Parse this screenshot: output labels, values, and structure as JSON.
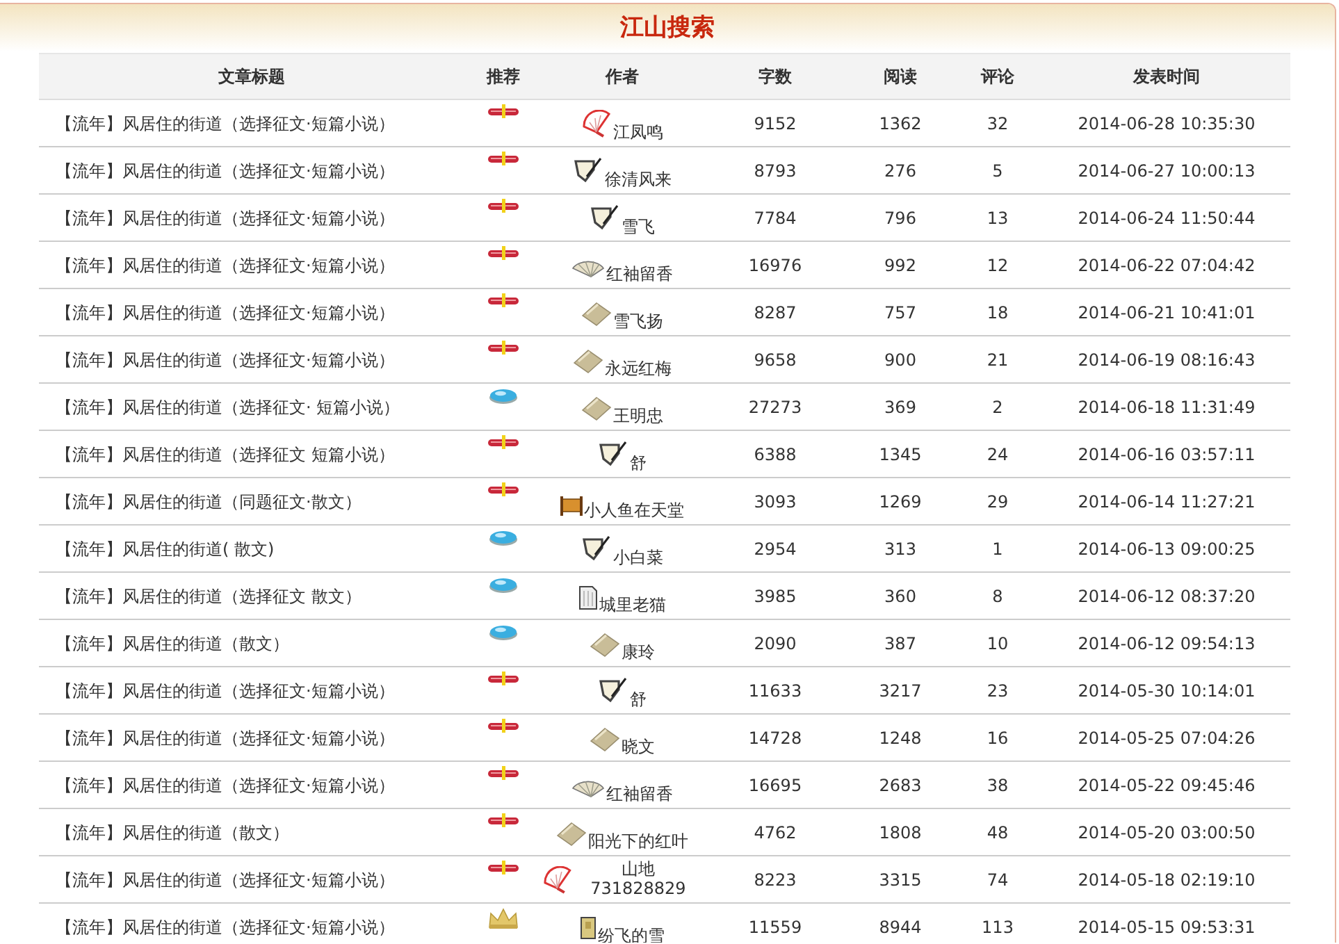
{
  "title": "江山搜索",
  "table": {
    "columns": [
      "文章标题",
      "推荐",
      "作者",
      "字数",
      "阅读",
      "评论",
      "发表时间"
    ],
    "rows": [
      {
        "title": "【流年】风居住的街道（选择征文·短篇小说）",
        "recommend": {
          "kind": "ribbon"
        },
        "author": {
          "kind": "fan-red",
          "name": "江凤鸣"
        },
        "words": "9152",
        "reads": "1362",
        "comments": "32",
        "time": "2014-06-28 10:35:30"
      },
      {
        "title": "【流年】风居住的街道（选择征文·短篇小说）",
        "recommend": {
          "kind": "ribbon"
        },
        "author": {
          "kind": "pen",
          "name": "徐清风来"
        },
        "words": "8793",
        "reads": "276",
        "comments": "5",
        "time": "2014-06-27 10:00:13"
      },
      {
        "title": "【流年】风居住的街道（选择征文·短篇小说）",
        "recommend": {
          "kind": "ribbon"
        },
        "author": {
          "kind": "pen",
          "name": "雪飞"
        },
        "words": "7784",
        "reads": "796",
        "comments": "13",
        "time": "2014-06-24 11:50:44"
      },
      {
        "title": "【流年】风居住的街道（选择征文·短篇小说）",
        "recommend": {
          "kind": "ribbon"
        },
        "author": {
          "kind": "fan",
          "name": "红袖留香"
        },
        "words": "16976",
        "reads": "992",
        "comments": "12",
        "time": "2014-06-22 07:04:42"
      },
      {
        "title": "【流年】风居住的街道（选择征文·短篇小说）",
        "recommend": {
          "kind": "ribbon"
        },
        "author": {
          "kind": "book",
          "name": "雪飞扬"
        },
        "words": "8287",
        "reads": "757",
        "comments": "18",
        "time": "2014-06-21 10:41:01"
      },
      {
        "title": "【流年】风居住的街道（选择征文·短篇小说）",
        "recommend": {
          "kind": "ribbon"
        },
        "author": {
          "kind": "book",
          "name": "永远红梅"
        },
        "words": "9658",
        "reads": "900",
        "comments": "21",
        "time": "2014-06-19 08:16:43"
      },
      {
        "title": "【流年】风居住的街道（选择征文· 短篇小说）",
        "recommend": {
          "kind": "gem"
        },
        "author": {
          "kind": "book",
          "name": "王明忠"
        },
        "words": "27273",
        "reads": "369",
        "comments": "2",
        "time": "2014-06-18 11:31:49"
      },
      {
        "title": "【流年】风居住的街道（选择征文 短篇小说）",
        "recommend": {
          "kind": "ribbon"
        },
        "author": {
          "kind": "pen",
          "name": "舒"
        },
        "words": "6388",
        "reads": "1345",
        "comments": "24",
        "time": "2014-06-16 03:57:11"
      },
      {
        "title": "【流年】风居住的街道（同题征文·散文）",
        "recommend": {
          "kind": "ribbon"
        },
        "author": {
          "kind": "scroll",
          "name": "小人鱼在天堂"
        },
        "words": "3093",
        "reads": "1269",
        "comments": "29",
        "time": "2014-06-14 11:27:21"
      },
      {
        "title": "【流年】风居住的街道( 散文)",
        "recommend": {
          "kind": "gem"
        },
        "author": {
          "kind": "pen",
          "name": "小白菜"
        },
        "words": "2954",
        "reads": "313",
        "comments": "1",
        "time": "2014-06-13 09:00:25"
      },
      {
        "title": "【流年】风居住的街道（选择征文 散文）",
        "recommend": {
          "kind": "gem"
        },
        "author": {
          "kind": "page",
          "name": "城里老猫"
        },
        "words": "3985",
        "reads": "360",
        "comments": "8",
        "time": "2014-06-12 08:37:20"
      },
      {
        "title": "【流年】风居住的街道（散文）",
        "recommend": {
          "kind": "gem"
        },
        "author": {
          "kind": "book",
          "name": "康玲"
        },
        "words": "2090",
        "reads": "387",
        "comments": "10",
        "time": "2014-06-12 09:54:13"
      },
      {
        "title": "【流年】风居住的街道（选择征文·短篇小说）",
        "recommend": {
          "kind": "ribbon"
        },
        "author": {
          "kind": "pen",
          "name": "舒"
        },
        "words": "11633",
        "reads": "3217",
        "comments": "23",
        "time": "2014-05-30 10:14:01"
      },
      {
        "title": "【流年】风居住的街道（选择征文·短篇小说）",
        "recommend": {
          "kind": "ribbon"
        },
        "author": {
          "kind": "book",
          "name": "晓文"
        },
        "words": "14728",
        "reads": "1248",
        "comments": "16",
        "time": "2014-05-25 07:04:26"
      },
      {
        "title": "【流年】风居住的街道（选择征文·短篇小说）",
        "recommend": {
          "kind": "ribbon"
        },
        "author": {
          "kind": "fan",
          "name": "红袖留香"
        },
        "words": "16695",
        "reads": "2683",
        "comments": "38",
        "time": "2014-05-22 09:45:46"
      },
      {
        "title": "【流年】风居住的街道（散文）",
        "recommend": {
          "kind": "ribbon"
        },
        "author": {
          "kind": "book",
          "name": "阳光下的红叶"
        },
        "words": "4762",
        "reads": "1808",
        "comments": "48",
        "time": "2014-05-20 03:00:50"
      },
      {
        "title": "【流年】风居住的街道（选择征文·短篇小说）",
        "recommend": {
          "kind": "ribbon"
        },
        "author": {
          "kind": "fan-red",
          "name": "山地731828829"
        },
        "words": "8223",
        "reads": "3315",
        "comments": "74",
        "time": "2014-05-18 02:19:10"
      },
      {
        "title": "【流年】风居住的街道（选择征文·短篇小说）",
        "recommend": {
          "kind": "crown"
        },
        "author": {
          "kind": "note",
          "name": "纷飞的雪"
        },
        "words": "11559",
        "reads": "8944",
        "comments": "113",
        "time": "2014-05-15 09:53:31"
      }
    ]
  }
}
